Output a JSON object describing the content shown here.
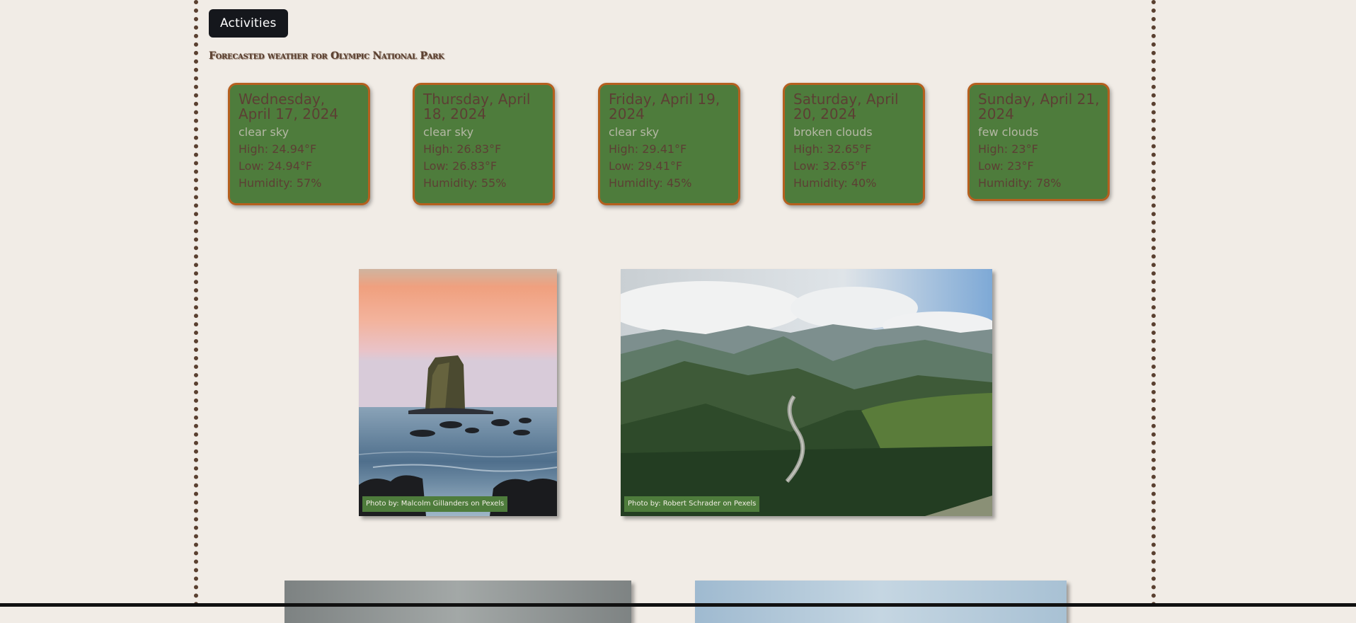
{
  "header": {
    "activities_label": "Activities",
    "forecast_title": "Forecasted weather for Olympic National Park"
  },
  "forecast": [
    {
      "date": "Wednesday, April 17, 2024",
      "description": "clear sky",
      "high": "High: 24.94°F",
      "low": "Low: 24.94°F",
      "humidity": "Humidity: 57%"
    },
    {
      "date": "Thursday, April 18, 2024",
      "description": "clear sky",
      "high": "High: 26.83°F",
      "low": "Low: 26.83°F",
      "humidity": "Humidity: 55%"
    },
    {
      "date": "Friday, April 19, 2024",
      "description": "clear sky",
      "high": "High: 29.41°F",
      "low": "Low: 29.41°F",
      "humidity": "Humidity: 45%"
    },
    {
      "date": "Saturday, April 20, 2024",
      "description": "broken clouds",
      "high": "High: 32.65°F",
      "low": "Low: 32.65°F",
      "humidity": "Humidity: 40%"
    },
    {
      "date": "Sunday, April 21, 2024",
      "description": "few clouds",
      "high": "High: 23°F",
      "low": "Low: 23°F",
      "humidity": "Humidity: 78%"
    }
  ],
  "photos": [
    {
      "credit": "Photo by: Malcolm Gillanders on Pexels",
      "icon": "sea-stack-photo"
    },
    {
      "credit": "Photo by: Robert Schrader on Pexels",
      "icon": "mountain-road-photo"
    },
    {
      "credit": "",
      "icon": "landscape-photo"
    },
    {
      "credit": "",
      "icon": "landscape-photo"
    }
  ],
  "colors": {
    "background": "#f1ece6",
    "card_green": "#4e7c3c",
    "card_border": "#b5601f",
    "border_brown": "#5a4030",
    "button_dark": "#15171c"
  }
}
